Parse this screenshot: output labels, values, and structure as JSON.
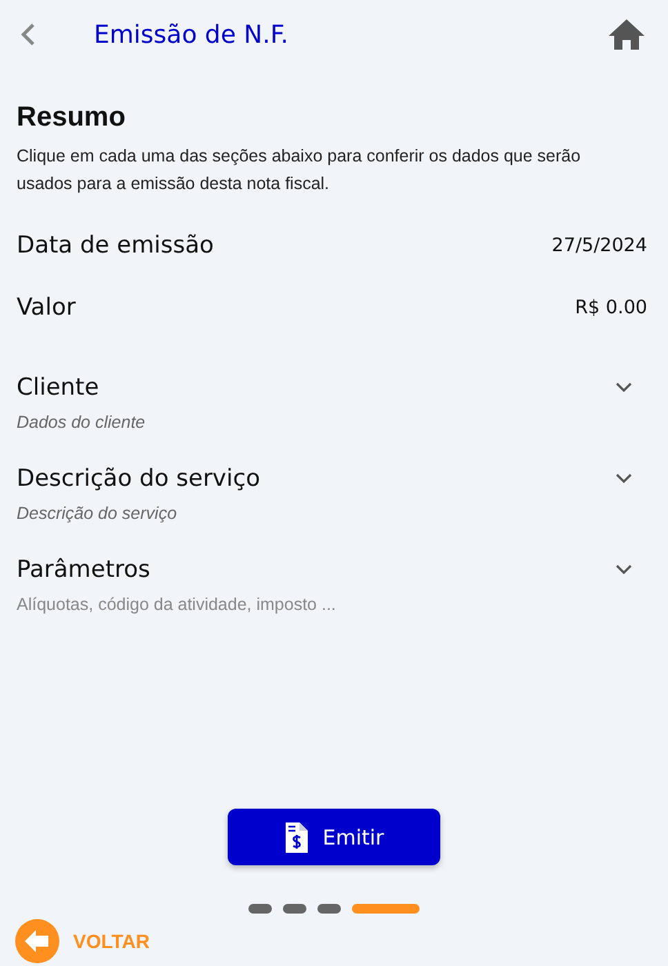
{
  "header": {
    "title": "Emissão de N.F."
  },
  "summary": {
    "title": "Resumo",
    "description": "Clique em cada uma das seções abaixo para conferir os dados que serão usados para a emissão desta nota fiscal."
  },
  "fields": [
    {
      "label": "Data de emissão",
      "value": "27/5/2024"
    },
    {
      "label": "Valor",
      "value": "R$ 0.00"
    }
  ],
  "sections": [
    {
      "title": "Cliente",
      "subtitle": "Dados do cliente",
      "expanded": false
    },
    {
      "title": "Descrição do serviço",
      "subtitle": "Descrição do serviço",
      "expanded": false
    },
    {
      "title": "Parâmetros",
      "subtitle": "Alíquotas, código da atividade, imposto ...",
      "expanded": false
    }
  ],
  "action": {
    "label": "Emitir"
  },
  "steps": [
    {
      "selected": false
    },
    {
      "selected": false
    },
    {
      "selected": false
    },
    {
      "selected": true
    }
  ],
  "back": {
    "label": "VOLTAR"
  }
}
